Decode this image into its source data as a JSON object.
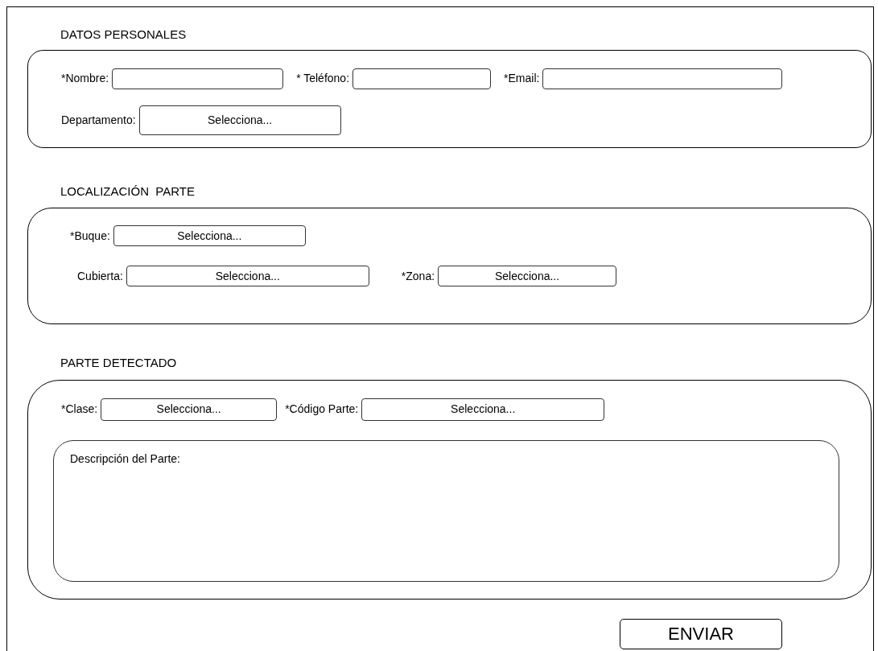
{
  "sections": [
    {
      "title": "DATOS PERSONALES",
      "rows": [
        [
          {
            "kind": "text",
            "label": "*Nombre:"
          },
          {
            "kind": "text",
            "label": "* Teléfono:"
          },
          {
            "kind": "text",
            "label": "*Email:"
          }
        ],
        [
          {
            "kind": "select",
            "label": "Departamento:",
            "value": "Selecciona..."
          }
        ]
      ]
    },
    {
      "title": "LOCALIZACIÓN  PARTE",
      "rows": [
        [
          {
            "kind": "select",
            "label": "*Buque:",
            "value": "Selecciona..."
          }
        ],
        [
          {
            "kind": "select",
            "label": "Cubierta:",
            "value": "Selecciona..."
          },
          {
            "kind": "select",
            "label": "*Zona:",
            "value": "Selecciona..."
          }
        ]
      ]
    },
    {
      "title": "PARTE DETECTADO",
      "rows": [
        [
          {
            "kind": "select",
            "label": "*Clase:",
            "value": "Selecciona..."
          },
          {
            "kind": "select",
            "label": "*Código Parte:",
            "value": "Selecciona..."
          }
        ],
        [
          {
            "kind": "textarea",
            "label": "Descripción del Parte:"
          }
        ]
      ]
    }
  ],
  "submit": "ENVIAR"
}
